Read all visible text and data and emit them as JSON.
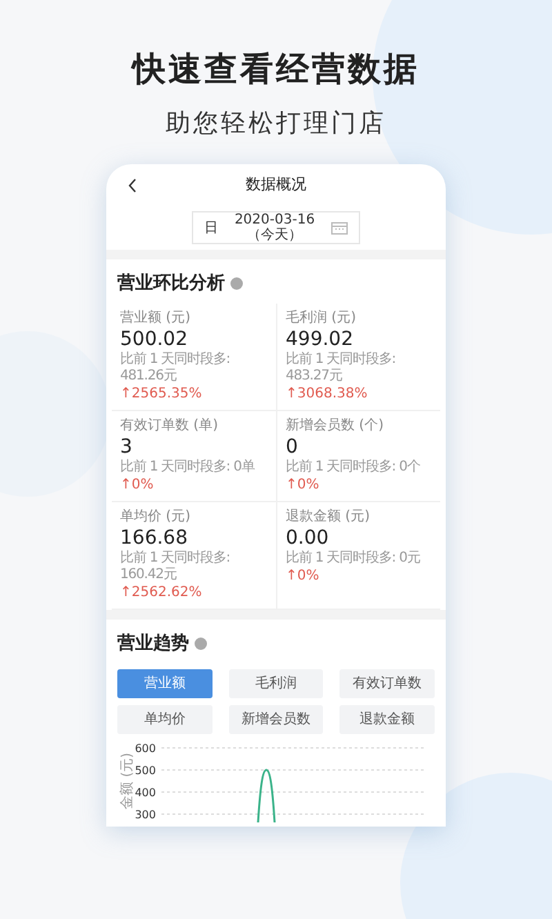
{
  "headline": "快速查看经营数据",
  "subheadline": "助您轻松打理门店",
  "phone": {
    "nav": {
      "title": "数据概况"
    },
    "date_filter": {
      "period": "日",
      "date": "2020-03-16（今天）"
    },
    "analysis": {
      "title": "营业环比分析",
      "metrics": [
        {
          "label": "营业额 (元)",
          "value": "500.02",
          "compare": "比前 1 天同时段多: 481.26元",
          "change": "↑2565.35%"
        },
        {
          "label": "毛利润 (元)",
          "value": "499.02",
          "compare": "比前 1 天同时段多: 483.27元",
          "change": "↑3068.38%"
        },
        {
          "label": "有效订单数 (单)",
          "value": "3",
          "compare": "比前 1 天同时段多: 0单",
          "change": "↑0%"
        },
        {
          "label": "新增会员数 (个)",
          "value": "0",
          "compare": "比前 1 天同时段多: 0个",
          "change": "↑0%"
        },
        {
          "label": "单均价 (元)",
          "value": "166.68",
          "compare": "比前 1 天同时段多: 160.42元",
          "change": "↑2562.62%"
        },
        {
          "label": "退款金额 (元)",
          "value": "0.00",
          "compare": "比前 1 天同时段多: 0元",
          "change": "↑0%"
        }
      ]
    },
    "trend": {
      "title": "营业趋势",
      "tabs": [
        {
          "label": "营业额",
          "selected": true
        },
        {
          "label": "毛利润",
          "selected": false
        },
        {
          "label": "有效订单数",
          "selected": false
        },
        {
          "label": "单均价",
          "selected": false
        },
        {
          "label": "新增会员数",
          "selected": false
        },
        {
          "label": "退款金额",
          "selected": false
        }
      ],
      "chart": {
        "y_axis_label": "金额 (元)",
        "y_ticks": [
          "600",
          "500",
          "400",
          "300"
        ]
      }
    }
  }
}
